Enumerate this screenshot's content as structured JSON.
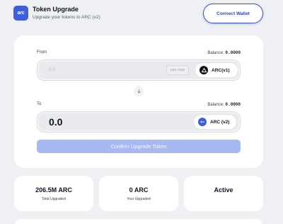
{
  "header": {
    "logo_text": "arc",
    "title": "Token Upgrade",
    "subtitle": "Upgrade your tokens to ARC (v2)",
    "connect_label": "Connect Wallet"
  },
  "from": {
    "label": "From",
    "balance_label": "Balance:",
    "balance_value": "0.0000",
    "amount": "0.0",
    "use_max": "use max",
    "token": "ARC(v1)",
    "token_icon": "arc-v1-icon"
  },
  "swap": {
    "icon": "arrow-down-icon"
  },
  "to": {
    "label": "To",
    "balance_label": "Balance:",
    "balance_value": "0.0000",
    "amount": "0.0",
    "token": "ARC (v2)",
    "token_icon_text": "arc"
  },
  "confirm_label": "Confirm Upgrade Token",
  "stats": [
    {
      "value": "206.5M ARC",
      "label": "Total Upgraded"
    },
    {
      "value": "0 ARC",
      "label": "Your Upgraded"
    },
    {
      "value": "Active",
      "label": ""
    }
  ],
  "colors": {
    "accent": "#3f5fd8",
    "button_disabled": "#a6b9f3",
    "background": "#eef0f3"
  }
}
